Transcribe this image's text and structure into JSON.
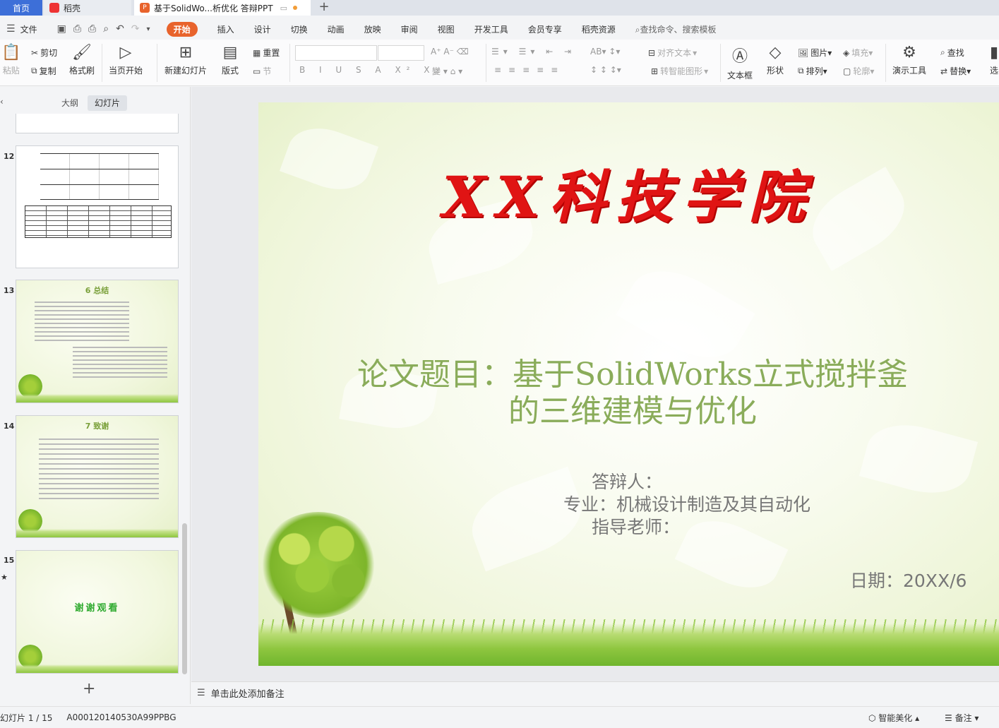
{
  "tabs": {
    "home": "首页",
    "doc1": "稻壳",
    "doc2": "基于SolidWo...析优化 答辩PPT",
    "add": "+"
  },
  "menu": {
    "file": "文件",
    "items": [
      "开始",
      "插入",
      "设计",
      "切换",
      "动画",
      "放映",
      "审阅",
      "视图",
      "开发工具",
      "会员专享",
      "稻壳资源"
    ],
    "search": "查找命令、搜索模板"
  },
  "ribbon": {
    "paste": "粘贴",
    "cut": "剪切",
    "copy": "复制",
    "format_painter": "格式刷",
    "play_from_current": "当页开始",
    "new_slide": "新建幻灯片",
    "layout": "版式",
    "reset": "重置",
    "section": "节",
    "align_text": "对齐文本",
    "convert_smartart": "转智能图形",
    "textbox": "文本框",
    "shape": "形状",
    "picture": "图片",
    "arrange": "排列",
    "fill": "填充",
    "outline": "轮廓",
    "presentation_tools": "演示工具",
    "find": "查找",
    "replace": "替换",
    "select": "选"
  },
  "left_panel": {
    "outline_tab": "大纲",
    "slides_tab": "幻灯片",
    "thumbnails": [
      {
        "num": "12",
        "title": ""
      },
      {
        "num": "13",
        "title": "6 总结"
      },
      {
        "num": "14",
        "title": "7 致谢"
      },
      {
        "num": "15",
        "title": "谢谢观看"
      }
    ]
  },
  "slide": {
    "title": "XX科技学院",
    "subtitle_line1": "论文题目：基于SolidWorks立式搅拌釜",
    "subtitle_line2": "的三维建模与优化",
    "defender": "答辩人：",
    "major": "专业：机械设计制造及其自动化",
    "advisor": "指导老师：",
    "date": "日期：20XX/6"
  },
  "notes_placeholder": "单击此处添加备注",
  "status": {
    "slide_count": "幻灯片 1 / 15",
    "template_id": "A000120140530A99PPBG",
    "smart_beautify": "智能美化",
    "notes": "备注"
  }
}
